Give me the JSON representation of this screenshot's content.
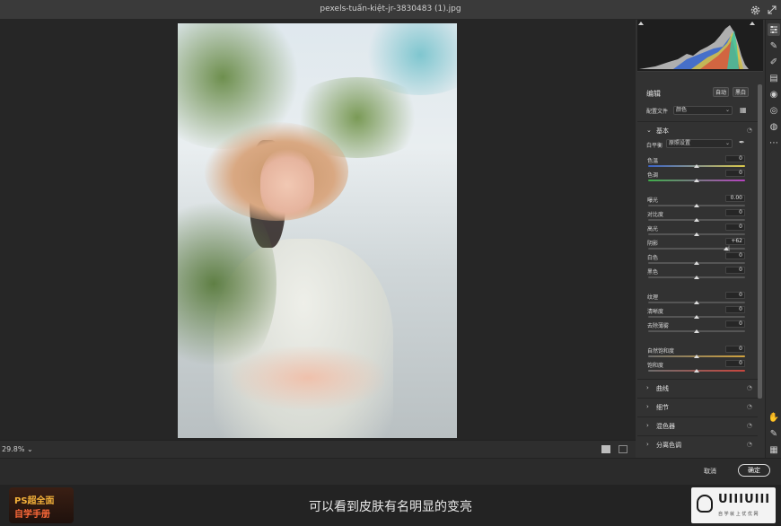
{
  "window": {
    "title": "pexels-tuấn-kiệt-jr-3830483 (1).jpg"
  },
  "titlebar_icons": [
    "gear-icon",
    "expand-icon"
  ],
  "canvas": {
    "zoom": "29.8%",
    "zoom_chevron": "⌄"
  },
  "panel": {
    "title": "编辑",
    "auto_label": "自动",
    "bw_label": "黑白",
    "profile_label": "配置文件",
    "profile_value": "颜色",
    "basic": {
      "header": "基本",
      "wb_label": "白平衡",
      "wb_value": "原照设置",
      "sliders": [
        {
          "label": "色温",
          "value": "0",
          "track": "temp"
        },
        {
          "label": "色调",
          "value": "0",
          "track": "tint"
        },
        {
          "label": "曝光",
          "value": "0.00",
          "track": "gray"
        },
        {
          "label": "对比度",
          "value": "0",
          "track": "gray"
        },
        {
          "label": "高光",
          "value": "0",
          "track": "gray"
        },
        {
          "label": "阴影",
          "value": "+62",
          "track": "gray",
          "fraction": 0.81
        },
        {
          "label": "白色",
          "value": "0",
          "track": "gray"
        },
        {
          "label": "黑色",
          "value": "0",
          "track": "gray"
        },
        {
          "label": "纹理",
          "value": "0",
          "track": "gray"
        },
        {
          "label": "清晰度",
          "value": "0",
          "track": "gray"
        },
        {
          "label": "去除薄雾",
          "value": "0",
          "track": "gray"
        },
        {
          "label": "自然饱和度",
          "value": "0",
          "track": "vib"
        },
        {
          "label": "饱和度",
          "value": "0",
          "track": "sat"
        }
      ]
    },
    "sections": [
      "曲线",
      "细节",
      "混色器",
      "分离色调"
    ]
  },
  "footer": {
    "cancel": "取消",
    "ok": "确定"
  },
  "caption": {
    "subtitle": "可以看到皮肤有名明显的变亮",
    "logo_left_line1": "PS超全面",
    "logo_left_line2": "自学手册",
    "logo_right_brand": "UIIIUIII",
    "logo_right_tag": "自 学 就 上 优 优 网"
  },
  "colors": {
    "accent": "#d9a17a",
    "panel_bg": "#323232",
    "canvas_bg": "#262626"
  }
}
